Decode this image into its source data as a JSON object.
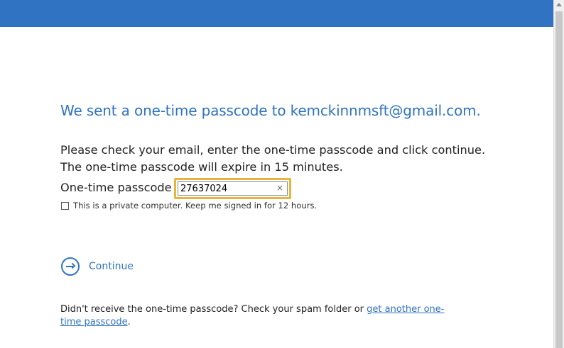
{
  "colors": {
    "brand_blue": "#2f73c2",
    "focus_outline": "#e7b53b"
  },
  "heading": "We sent a one-time passcode to kemckinnmsft@gmail.com.",
  "instructions": {
    "line1": "Please check your email, enter the one-time passcode and click continue.",
    "line2": "The one-time passcode will expire in 15 minutes."
  },
  "passcode": {
    "label": "One-time passcode",
    "value": "27637024",
    "clear_icon": "×"
  },
  "keep_signed_in": {
    "checked": false,
    "label": "This is a private computer. Keep me signed in for 12 hours."
  },
  "continue": {
    "label": "Continue",
    "icon": "arrow-right-circle-icon"
  },
  "footer": {
    "text": "Didn't receive the one-time passcode? Check your spam folder or ",
    "link": "get another one-time passcode",
    "end": "."
  }
}
